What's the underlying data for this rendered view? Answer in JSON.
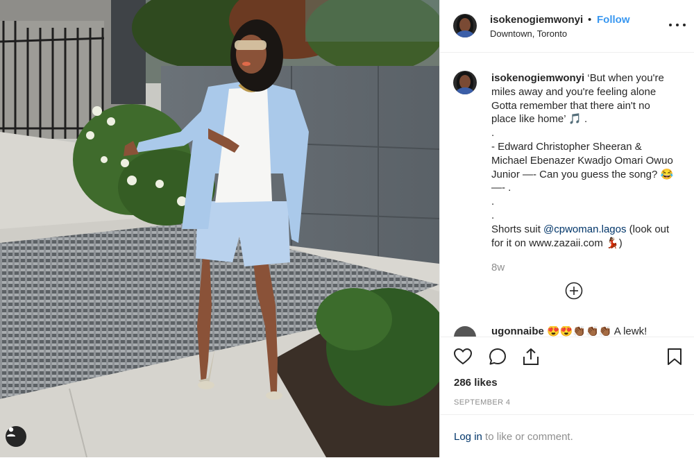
{
  "post": {
    "username": "isokenogiemwonyi",
    "separator": "•",
    "follow_label": "Follow",
    "location": "Downtown, Toronto",
    "caption_lines": [
      "‘But when you're",
      "miles away and you're feeling alone",
      "Gotta remember that there ain't no",
      "place like home’ 🎵 .",
      ".",
      "- Edward Christopher Sheeran &",
      "Michael Ebenazer Kwadjo Omari Owuo",
      "Junior —- Can you guess the song? 😂",
      "—- .",
      ".",
      "."
    ],
    "shorts_prefix": "Shorts suit ",
    "mention": "@cpwoman.lagos",
    "shorts_suffix": " (look out",
    "last_line": "for it on www.zazaii.com 💃🏾)",
    "time_ago": "8w",
    "next_comment": {
      "username": "ugonnaibe",
      "text": "😍😍👏🏾👏🏾👏🏾 A lewk!"
    },
    "likes": "286 likes",
    "date": "SEPTEMBER 4",
    "login_link": "Log in",
    "login_rest": " to like or comment."
  },
  "icons": {
    "like": "heart-icon",
    "comment": "comment-icon",
    "share": "share-icon",
    "save": "bookmark-icon",
    "more": "more-options-icon",
    "load_more": "plus-circle-icon",
    "user": "user-icon"
  },
  "colors": {
    "follow_blue": "#3897f0",
    "link_blue": "#003569",
    "text": "#262626",
    "muted": "#8e8e8e",
    "divider": "#efefef"
  }
}
